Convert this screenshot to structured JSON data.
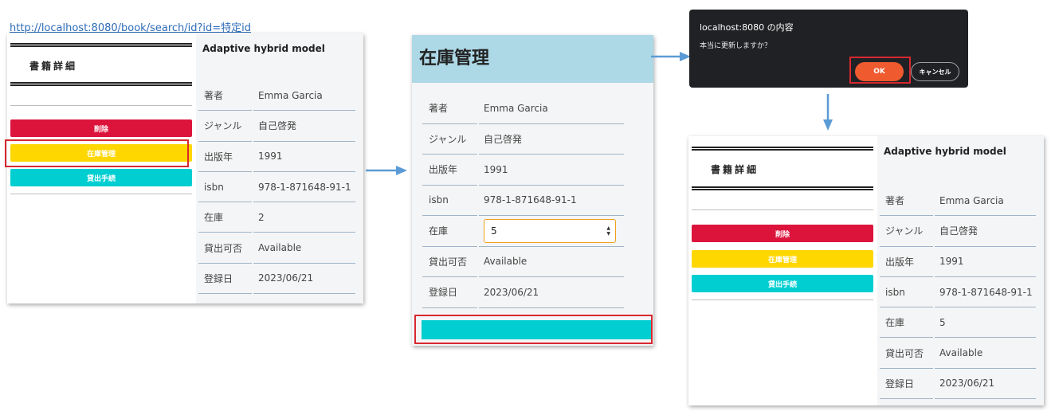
{
  "url": "http://localhost:8080/book/search/id?id=特定id",
  "detail_before": {
    "side_title": "書籍詳細",
    "buttons": {
      "delete": "削除",
      "inventory": "在庫管理",
      "lend": "貸出手続"
    },
    "book_title": "Adaptive hybrid model",
    "rows": [
      {
        "label": "著者",
        "value": "Emma Garcia"
      },
      {
        "label": "ジャンル",
        "value": "自己啓発"
      },
      {
        "label": "出版年",
        "value": "1991"
      },
      {
        "label": "isbn",
        "value": "978-1-871648-91-1"
      },
      {
        "label": "在庫",
        "value": "2"
      },
      {
        "label": "貸出可否",
        "value": "Available"
      },
      {
        "label": "登録日",
        "value": "2023/06/21"
      }
    ]
  },
  "inventory": {
    "header": "在庫管理",
    "rows": [
      {
        "label": "著者",
        "value": "Emma Garcia"
      },
      {
        "label": "ジャンル",
        "value": "自己啓発"
      },
      {
        "label": "出版年",
        "value": "1991"
      },
      {
        "label": "isbn",
        "value": "978-1-871648-91-1"
      },
      {
        "label": "在庫",
        "value": "5"
      },
      {
        "label": "貸出可否",
        "value": "Available"
      },
      {
        "label": "登録日",
        "value": "2023/06/21"
      }
    ],
    "spin_up": "▲",
    "spin_down": "▼"
  },
  "dialog": {
    "title": "localhost:8080 の内容",
    "message": "本当に更新しますか？",
    "ok": "OK",
    "cancel": "キャンセル"
  },
  "detail_after": {
    "side_title": "書籍詳細",
    "buttons": {
      "delete": "削除",
      "inventory": "在庫管理",
      "lend": "貸出手続"
    },
    "book_title": "Adaptive hybrid model",
    "rows": [
      {
        "label": "著者",
        "value": "Emma Garcia"
      },
      {
        "label": "ジャンル",
        "value": "自己啓発"
      },
      {
        "label": "出版年",
        "value": "1991"
      },
      {
        "label": "isbn",
        "value": "978-1-871648-91-1"
      },
      {
        "label": "在庫",
        "value": "5"
      },
      {
        "label": "貸出可否",
        "value": "Available"
      },
      {
        "label": "登録日",
        "value": "2023/06/21"
      }
    ]
  },
  "colors": {
    "delete": "#dc143c",
    "inventory": "#ffd700",
    "lend": "#00ced1",
    "header": "#add8e6",
    "highlight": "#d8282f",
    "arrow": "#5b9bd5",
    "dialog_bg": "#202124",
    "ok": "#ef5a2f"
  }
}
